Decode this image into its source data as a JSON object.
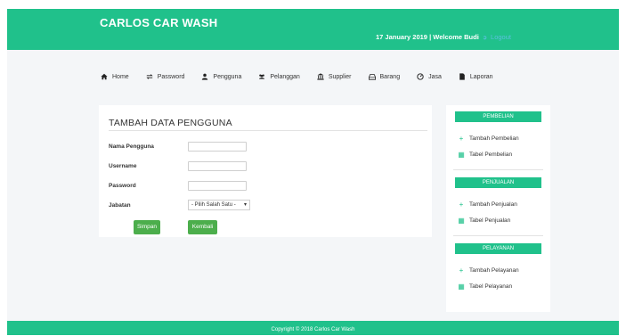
{
  "header": {
    "brand": "CARLOS CAR WASH",
    "date": "17 January 2019",
    "separator": "|",
    "welcome": "Welcome Budi",
    "logout": "Logout",
    "logout_icon": "logout-icon"
  },
  "nav": {
    "items": [
      {
        "label": "Home",
        "icon": "home-icon"
      },
      {
        "label": "Password",
        "icon": "exchange-icon"
      },
      {
        "label": "Pengguna",
        "icon": "user-icon"
      },
      {
        "label": "Pelanggan",
        "icon": "users-icon"
      },
      {
        "label": "Supplier",
        "icon": "bank-icon"
      },
      {
        "label": "Barang",
        "icon": "hdd-icon"
      },
      {
        "label": "Jasa",
        "icon": "gauge-icon"
      },
      {
        "label": "Laporan",
        "icon": "file-icon"
      }
    ]
  },
  "form": {
    "title": "TAMBAH DATA PENGGUNA",
    "fields": [
      {
        "label": "Nama Pengguna",
        "value": ""
      },
      {
        "label": "Username",
        "value": ""
      },
      {
        "label": "Password",
        "value": ""
      }
    ],
    "jabatan_label": "Jabatan",
    "jabatan_selected": "- Pilih Salah Satu -",
    "save_label": "Simpan",
    "back_label": "Kembali"
  },
  "sidebar": {
    "sections": [
      {
        "title": "PEMBELIAN",
        "items": [
          {
            "label": "Tambah Pembelian",
            "icon": "plus-icon"
          },
          {
            "label": "Tabel Pembelian",
            "icon": "table-icon"
          }
        ]
      },
      {
        "title": "PENJUALAN",
        "items": [
          {
            "label": "Tambah Penjualan",
            "icon": "plus-icon"
          },
          {
            "label": "Tabel Penjualan",
            "icon": "table-icon"
          }
        ]
      },
      {
        "title": "PELAYANAN",
        "items": [
          {
            "label": "Tambah Pelayanan",
            "icon": "plus-icon"
          },
          {
            "label": "Tabel Pelayanan",
            "icon": "table-icon"
          }
        ]
      }
    ]
  },
  "footer": {
    "text": "Copyright © 2018 Carlos Car Wash"
  },
  "colors": {
    "primary": "#20c18b",
    "button": "#4cae4c",
    "logout": "#5bc0de",
    "background": "#f4f6f8"
  }
}
